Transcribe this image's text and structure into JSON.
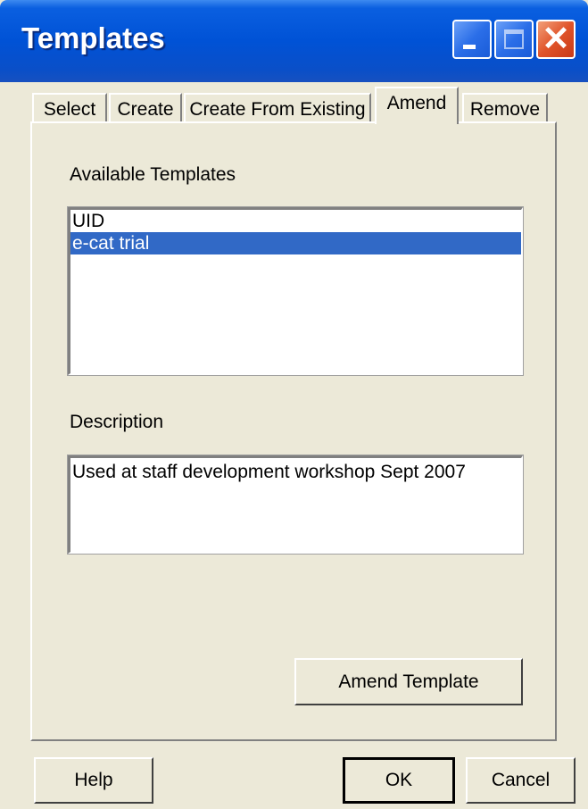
{
  "window": {
    "title": "Templates"
  },
  "tabs": [
    {
      "label": "Select"
    },
    {
      "label": "Create"
    },
    {
      "label": "Create From Existing"
    },
    {
      "label": "Amend"
    },
    {
      "label": "Remove"
    }
  ],
  "active_tab": "Amend",
  "amend": {
    "available_label": "Available Templates",
    "templates": [
      {
        "name": "UID",
        "selected": false
      },
      {
        "name": "e-cat trial",
        "selected": true
      }
    ],
    "description_label": "Description",
    "description_value": "Used at staff development workshop Sept 2007",
    "amend_button": "Amend Template"
  },
  "footer": {
    "help": "Help",
    "ok": "OK",
    "cancel": "Cancel"
  },
  "colors": {
    "titlebar": "#0052d6",
    "selection": "#3169c6",
    "face": "#ece9d8",
    "close_button": "#e0542a"
  },
  "icons": {
    "minimize": "minimize-icon",
    "maximize": "maximize-icon",
    "close": "close-icon"
  }
}
